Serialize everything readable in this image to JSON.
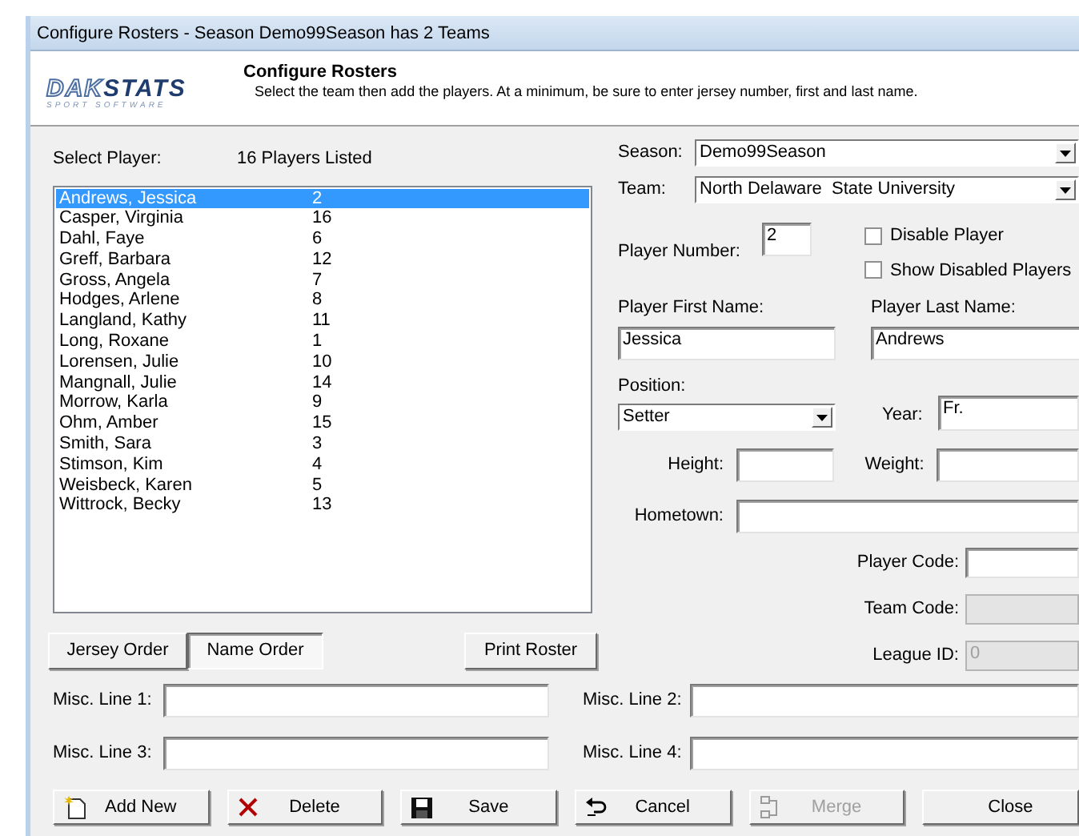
{
  "window": {
    "title": "Configure Rosters - Season Demo99Season has 2 Teams"
  },
  "header": {
    "logo": {
      "parts": [
        "DAK",
        "STATS"
      ],
      "tagline": "SPORT SOFTWARE"
    },
    "heading": "Configure Rosters",
    "instructions": "Select the team then add the players. At a minimum, be sure to enter jersey number, first and last name."
  },
  "player_list": {
    "label": "Select Player:",
    "count": "16 Players Listed",
    "rows": [
      {
        "name": "Andrews, Jessica",
        "number": "2",
        "selected": true
      },
      {
        "name": "Casper, Virginia",
        "number": "16",
        "selected": false
      },
      {
        "name": "Dahl, Faye",
        "number": "6",
        "selected": false
      },
      {
        "name": "Greff, Barbara",
        "number": "12",
        "selected": false
      },
      {
        "name": "Gross, Angela",
        "number": "7",
        "selected": false
      },
      {
        "name": "Hodges, Arlene",
        "number": "8",
        "selected": false
      },
      {
        "name": "Langland, Kathy",
        "number": "11",
        "selected": false
      },
      {
        "name": "Long, Roxane",
        "number": "1",
        "selected": false
      },
      {
        "name": "Lorensen, Julie",
        "number": "10",
        "selected": false
      },
      {
        "name": "Mangnall, Julie",
        "number": "14",
        "selected": false
      },
      {
        "name": "Morrow, Karla",
        "number": "9",
        "selected": false
      },
      {
        "name": "Ohm, Amber",
        "number": "15",
        "selected": false
      },
      {
        "name": "Smith, Sara",
        "number": "3",
        "selected": false
      },
      {
        "name": "Stimson, Kim",
        "number": "4",
        "selected": false
      },
      {
        "name": "Weisbeck, Karen",
        "number": "5",
        "selected": false
      },
      {
        "name": "Wittrock, Becky",
        "number": "13",
        "selected": false
      }
    ]
  },
  "sort_buttons": [
    {
      "label": "Jersey Order",
      "selected": false
    },
    {
      "label": "Name Order",
      "selected": true
    }
  ],
  "print_button": {
    "label": "Print Roster"
  },
  "season": {
    "label": "Season:",
    "value": "Demo99Season"
  },
  "team": {
    "label": "Team:",
    "value": "North Delaware  State University"
  },
  "player_number": {
    "label": "Player Number:",
    "value": "2"
  },
  "checkboxes": [
    {
      "label": "Disable Player",
      "checked": false
    },
    {
      "label": "Show Disabled Players",
      "checked": false
    }
  ],
  "first_name": {
    "label": "Player First Name:",
    "value": "Jessica"
  },
  "last_name": {
    "label": "Player Last Name:",
    "value": "Andrews"
  },
  "position": {
    "label": "Position:",
    "value": "Setter"
  },
  "year": {
    "label": "Year:",
    "value": "Fr."
  },
  "height": {
    "label": "Height:"
  },
  "weight": {
    "label": "Weight:"
  },
  "hometown": {
    "label": "Hometown:"
  },
  "codes": [
    {
      "label": "Player Code:",
      "disabled": false
    },
    {
      "label": "Team Code:",
      "disabled": true
    },
    {
      "label": "League ID:",
      "value": "0",
      "disabled": true
    }
  ],
  "misc_lines": [
    {
      "label": "Misc. Line 1:"
    },
    {
      "label": "Misc. Line 2:"
    },
    {
      "label": "Misc. Line 3:"
    },
    {
      "label": "Misc. Line 4:"
    }
  ],
  "actions": [
    {
      "label": "Add New",
      "kind": "add",
      "disabled": false
    },
    {
      "label": "Delete",
      "kind": "delete",
      "disabled": false
    },
    {
      "label": "Save",
      "kind": "save",
      "disabled": false
    },
    {
      "label": "Cancel",
      "kind": "cancel",
      "disabled": false
    },
    {
      "label": "Merge",
      "kind": "merge",
      "disabled": true
    },
    {
      "label": "Close",
      "kind": "close",
      "disabled": false
    }
  ]
}
